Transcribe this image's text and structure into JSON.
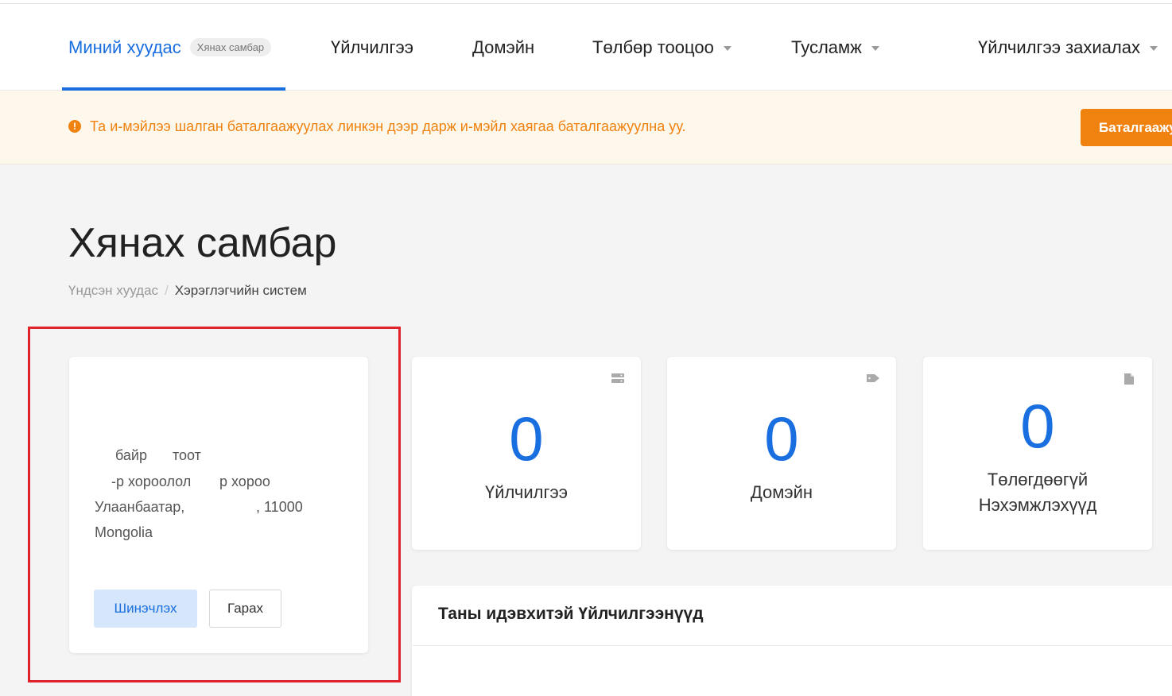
{
  "nav": {
    "my_page": "Миний хуудас",
    "my_page_badge": "Хянах самбар",
    "services": "Үйлчилгээ",
    "domains": "Домэйн",
    "billing": "Төлбөр тооцоо",
    "support": "Тусламж",
    "order": "Үйлчилгээ захиалах"
  },
  "alert": {
    "icon": "exclamation-circle-icon",
    "text": "Та и-мэйлээ шалган баталгаажуулах линкэн дээр дарж и-мэйл хаягаа баталгаажуулна уу.",
    "button": "Баталгаажуулах",
    "color": "#f0820f"
  },
  "page": {
    "title": "Хянах самбар",
    "breadcrumb": {
      "home": "Үндсэн хуудас",
      "separator": "/",
      "current": "Хэрэглэгчийн систем"
    }
  },
  "profile": {
    "line1_a": "байр",
    "line1_b": "тоот",
    "line2_a": "-р хороолол",
    "line2_b": "р хороо",
    "line3_a": "Улаанбаатар,",
    "line3_b": ", 11000",
    "line4": "Mongolia",
    "update_button": "Шинэчлэх",
    "logout_button": "Гарах"
  },
  "stats": [
    {
      "number": "0",
      "label": "Үйлчилгээ",
      "icon": "server-icon"
    },
    {
      "number": "0",
      "label": "Домэйн",
      "icon": "tag-icon"
    },
    {
      "number": "0",
      "label_line1": "Төлөгдөөгүй",
      "label_line2": "Нэхэмжлэхүүд",
      "icon": "file-icon"
    }
  ],
  "services_panel": {
    "title": "Таны идэвхитэй Үйлчилгээнүүд"
  },
  "colors": {
    "accent": "#1a6fe0",
    "warning": "#f0820f",
    "highlight": "#e0232b"
  }
}
